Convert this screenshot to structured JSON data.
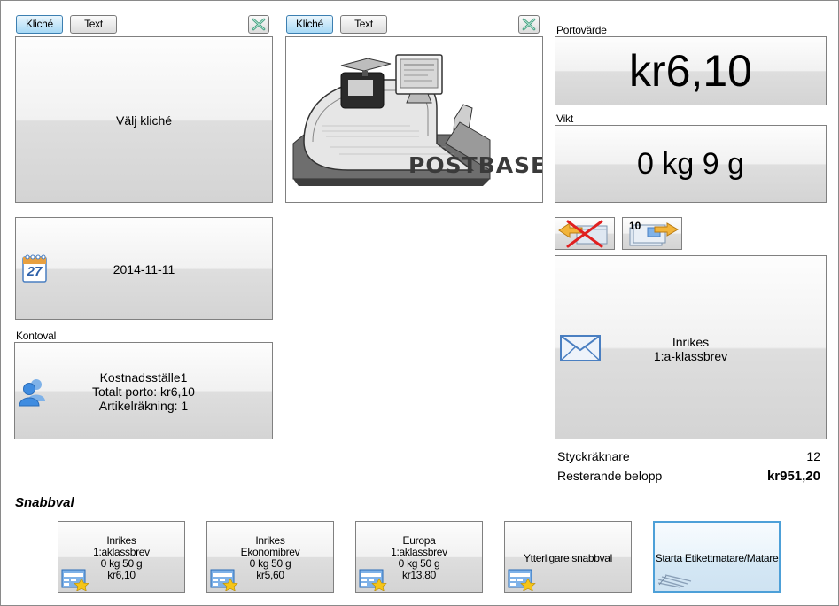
{
  "left_panel": {
    "tab_kliche": "Kliché",
    "tab_text": "Text",
    "kliche_label": "Välj kliché"
  },
  "middle_panel": {
    "tab_kliche": "Kliché",
    "tab_text": "Text",
    "brand_text": "POSTBASE"
  },
  "date_button": {
    "value": "2014-11-11",
    "icon": "calendar-icon",
    "calendar_day": "27"
  },
  "account": {
    "label": "Kontoval",
    "name": "Kostnadsställe1",
    "total": "Totalt porto: kr6,10",
    "items": "Artikelräkning: 1",
    "icon": "user-icon"
  },
  "postage": {
    "label": "Portovärde",
    "value": "kr6,10"
  },
  "weight": {
    "label": "Vikt",
    "value": "0 kg 9 g"
  },
  "batch_button": {
    "count": "10"
  },
  "product": {
    "line1": "Inrikes",
    "line2": "1:a-klassbrev",
    "icon": "envelope-icon"
  },
  "counters": {
    "piece_label": "Styckräknare",
    "piece_value": "12",
    "remaining_label": "Resterande belopp",
    "remaining_value": "kr951,20"
  },
  "quick": {
    "title": "Snabbval",
    "items": [
      {
        "l1": "Inrikes",
        "l2": "1:aklassbrev",
        "l3": "0 kg 50 g",
        "l4": "kr6,10"
      },
      {
        "l1": "Inrikes",
        "l2": "Ekonomibrev",
        "l3": "0 kg 50 g",
        "l4": "kr5,60"
      },
      {
        "l1": "Europa",
        "l2": "1:aklassbrev",
        "l3": "0 kg 50 g",
        "l4": "kr13,80"
      },
      {
        "label": "Ytterligare snabbval"
      },
      {
        "label": "Starta Etikettmatare/Matare"
      }
    ]
  },
  "colors": {
    "accent_border": "#4da0d8",
    "tab_active": "#a7d9f5",
    "icon_blue": "#4a7fc1"
  }
}
